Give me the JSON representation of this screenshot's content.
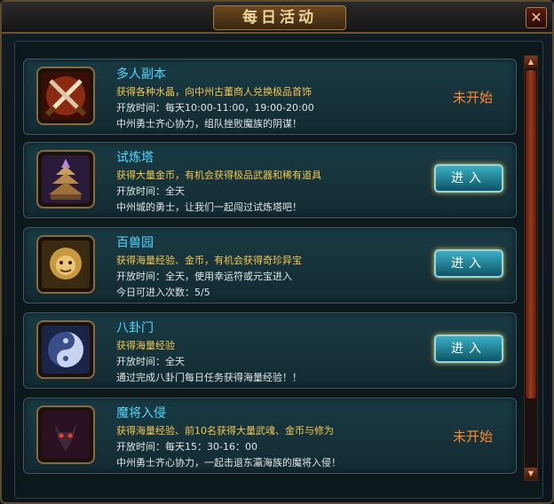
{
  "window": {
    "title": "每日活动",
    "close_label": "✕"
  },
  "activities": [
    {
      "title": "多人副本",
      "desc": "获得各种水晶，向中州古董商人兑换极品首饰",
      "time": "开放时间：每天10:00-11:00，19:00-20:00",
      "note": "中州勇士齐心协力，组队挫败魔族的阴谋！",
      "status": "未开始",
      "icon": "crossed-swords-icon"
    },
    {
      "title": "试炼塔",
      "desc": "获得大量金币，有机会获得极品武器和稀有道具",
      "time": "开放时间：全天",
      "note": "中州城的勇士，让我们一起闯过试炼塔吧！",
      "button": "进入",
      "icon": "pagoda-tower-icon"
    },
    {
      "title": "百兽园",
      "desc": "获得海量经验、金币，有机会获得奇珍异宝",
      "time": "开放时间：全天，使用幸运符或元宝进入",
      "note": "今日可进入次数：5/5",
      "button": "进入",
      "icon": "golden-beast-icon"
    },
    {
      "title": "八卦门",
      "desc": "获得海量经验",
      "time": "开放时间：全天",
      "note": "通过完成八卦门每日任务获得海量经验！！",
      "button": "进入",
      "icon": "yin-yang-icon"
    },
    {
      "title": "魔将入侵",
      "desc": "获得海量经验、前10名获得大量武魂、金币与修为",
      "time": "开放时间：每天15：30-16：00",
      "note": "中州勇士齐心协力，一起击退东瀛海族的魔将入侵！",
      "status": "未开始",
      "icon": "dark-wolf-icon"
    }
  ],
  "scrollbar": {
    "up": "▲",
    "down": "▼"
  },
  "colors": {
    "title_cyan": "#4fd8ff",
    "desc_gold": "#f2c94c",
    "status_orange": "#ff8a2a",
    "button_teal": "#1a8ca0"
  }
}
